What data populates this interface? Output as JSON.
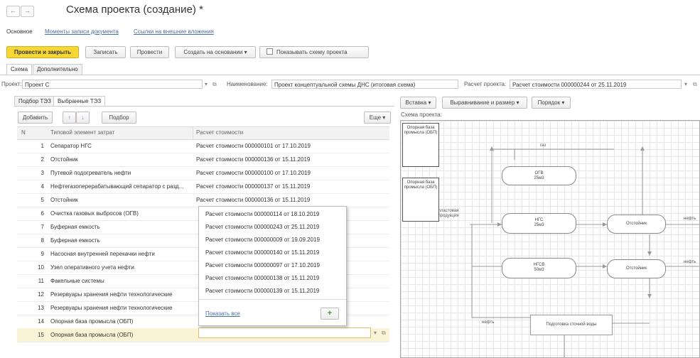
{
  "window": {
    "title": "Схема проекта (создание) *",
    "back": "←",
    "forward": "→"
  },
  "nav_links": {
    "main": "Основное",
    "moments": "Моменты записи документа",
    "external": "Ссылки на внешние вложения"
  },
  "toolbar": {
    "post_close": "Провести и закрыть",
    "save": "Записать",
    "post": "Провести",
    "create_based": "Создать на основании ▾",
    "show_scheme": "Показывать схему проекта"
  },
  "subtabs": {
    "scheme": "Схема",
    "additional": "Дополнительно"
  },
  "fields": {
    "project_label": "Проект:",
    "project_value": "Проект С",
    "name_label": "Наименование:",
    "name_value": "Проект концептуальной схемы ДНС (итоговая схема)",
    "calc_label": "Расчет проекта:",
    "calc_value": "Расчет стоимости 000000244 от 25.11.2019"
  },
  "left_tabs": {
    "pick": "Подбор ТЭЗ",
    "selected": "Выбранные ТЭЗ"
  },
  "list_toolbar": {
    "add": "Добавить",
    "pick": "Подбор",
    "more": "Еще ▾"
  },
  "table": {
    "headers": [
      "N",
      "Типовой элемент затрат",
      "Расчет стоимости"
    ],
    "rows": [
      {
        "n": "1",
        "el": "Сепаратор НГС",
        "calc": "Расчет стоимости 000000101 от 17.10.2019"
      },
      {
        "n": "2",
        "el": "Отстойник",
        "calc": "Расчет стоимости 000000136 от 15.11.2019"
      },
      {
        "n": "3",
        "el": "Путевой подогреватель нефти",
        "calc": "Расчет стоимости 000000100 от 17.10.2019"
      },
      {
        "n": "4",
        "el": "Нефтегазоперерабатывающий сепаратор с разд...",
        "calc": "Расчет стоимости 000000137 от 15.11.2019"
      },
      {
        "n": "5",
        "el": "Отстойник",
        "calc": "Расчет стоимости 000000136 от 15.11.2019"
      },
      {
        "n": "6",
        "el": "Очистка газовых выбросов (ОГВ)",
        "calc": ""
      },
      {
        "n": "7",
        "el": "Буферная емкость",
        "calc": ""
      },
      {
        "n": "8",
        "el": "Буферная емкость",
        "calc": ""
      },
      {
        "n": "9",
        "el": "Насосная внутренней перекачки нефти",
        "calc": ""
      },
      {
        "n": "10",
        "el": "Узел оперативного учета нефти",
        "calc": ""
      },
      {
        "n": "11",
        "el": "Факельные системы",
        "calc": ""
      },
      {
        "n": "12",
        "el": "Резервуары хранения нефти технологические",
        "calc": ""
      },
      {
        "n": "13",
        "el": "Резервуары хранения нефти технологические",
        "calc": ""
      },
      {
        "n": "14",
        "el": "Опорная база промысла (ОБП)",
        "calc": ""
      },
      {
        "n": "15",
        "el": "Опорная база промысла (ОБП)",
        "calc": ""
      }
    ]
  },
  "dropdown": {
    "items": [
      "Расчет стоимости 000000114 от 18.10.2019",
      "Расчет стоимости 000000243 от 25.11.2019",
      "Расчет стоимости 000000009 от 19.09.2019",
      "Расчет стоимости 000000140 от 15.11.2019",
      "Расчет стоимости 000000097 от 17.10.2019",
      "Расчет стоимости 000000138 от 15.11.2019",
      "Расчет стоимости 000000139 от 15.11.2019"
    ],
    "show_all": "Показать все",
    "add": "+"
  },
  "diagram_toolbar": {
    "insert": "Вставка ▾",
    "align": "Выравнивание и размер ▾",
    "order": "Порядок ▾"
  },
  "diagram": {
    "label": "Схема проекта:",
    "obp1": "Опорная база промысла (ОБП)",
    "obp2": "Опорная база промысла (ОБП)",
    "gas": "газ",
    "ogv_title": "ОГВ",
    "ogv_vol": "25м3",
    "ngs_title": "НГС",
    "ngs_vol": "25м3",
    "ngsv_title": "НГСВ",
    "ngsv_vol": "50м3",
    "settler1": "Отстойник",
    "settler2": "Отстойник",
    "formation": "пластовая продукция",
    "oil1": "нефть",
    "oil2": "нефть",
    "oil3": "нефть",
    "water": "Подготовка сточной воды"
  }
}
